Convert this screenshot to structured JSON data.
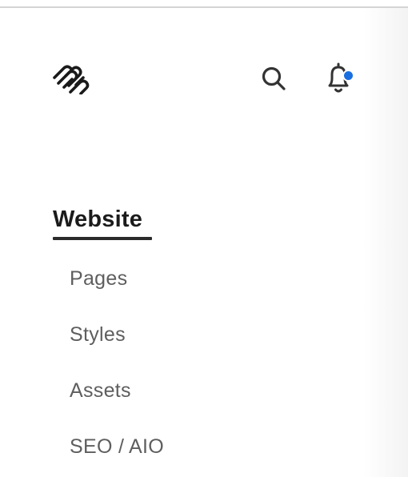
{
  "header": {
    "logo_icon": "squarespace-logo-icon",
    "search_icon": "search-icon",
    "notifications_icon": "bell-icon",
    "notification_dot_color": "#1a6fe0",
    "has_unread_notifications": true
  },
  "nav": {
    "section_title": "Website",
    "items": [
      {
        "label": "Pages"
      },
      {
        "label": "Styles"
      },
      {
        "label": "Assets"
      },
      {
        "label": "SEO / AIO"
      }
    ]
  }
}
